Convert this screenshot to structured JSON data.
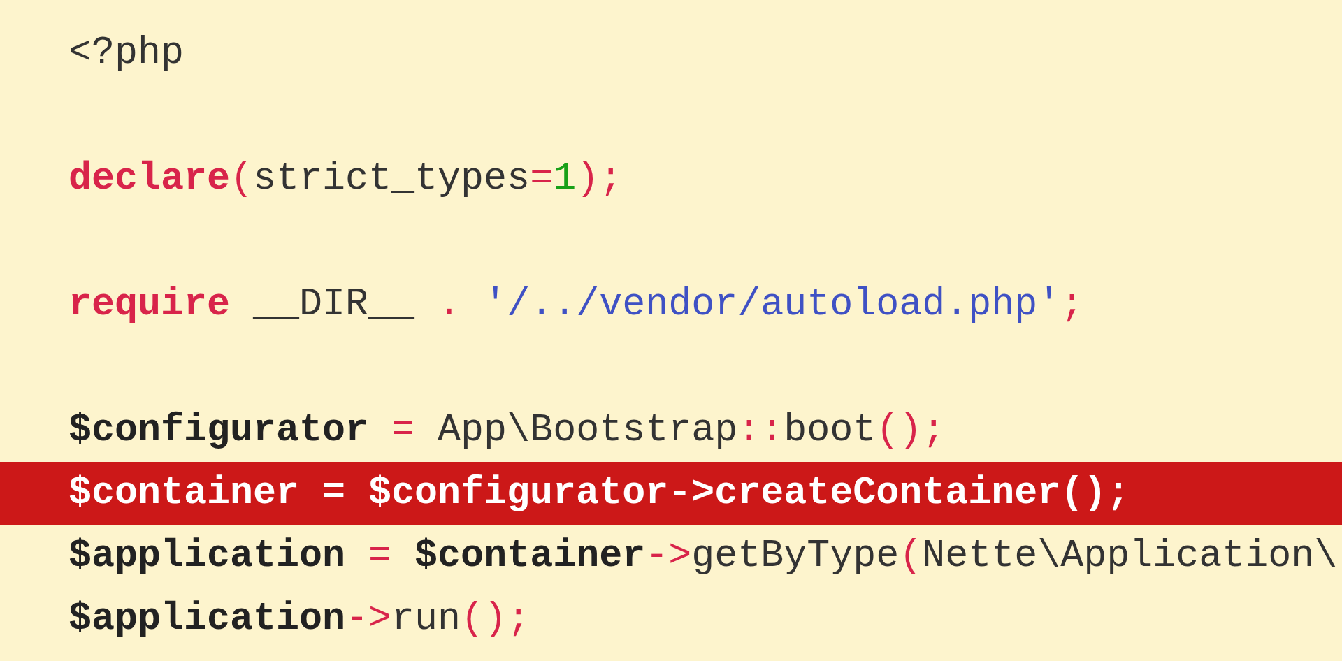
{
  "code_lines": [
    {
      "kind": "code",
      "highlighted": false,
      "tokens": [
        {
          "text": "<?php",
          "kind": "plain"
        }
      ]
    },
    {
      "kind": "blank"
    },
    {
      "kind": "code",
      "highlighted": false,
      "tokens": [
        {
          "text": "declare",
          "kind": "keyword"
        },
        {
          "text": "(",
          "kind": "operator"
        },
        {
          "text": "strict_types",
          "kind": "plain"
        },
        {
          "text": "=",
          "kind": "operator"
        },
        {
          "text": "1",
          "kind": "number"
        },
        {
          "text": ");",
          "kind": "operator"
        }
      ]
    },
    {
      "kind": "blank"
    },
    {
      "kind": "code",
      "highlighted": false,
      "tokens": [
        {
          "text": "require",
          "kind": "keyword"
        },
        {
          "text": " __DIR__ ",
          "kind": "plain"
        },
        {
          "text": ". ",
          "kind": "operator"
        },
        {
          "text": "'/../vendor/autoload.php'",
          "kind": "string"
        },
        {
          "text": ";",
          "kind": "operator"
        }
      ]
    },
    {
      "kind": "blank"
    },
    {
      "kind": "code",
      "highlighted": false,
      "tokens": [
        {
          "text": "$configurator",
          "kind": "variable"
        },
        {
          "text": " = ",
          "kind": "operator"
        },
        {
          "text": "App\\Bootstrap",
          "kind": "plain"
        },
        {
          "text": "::",
          "kind": "operator"
        },
        {
          "text": "boot",
          "kind": "plain"
        },
        {
          "text": "();",
          "kind": "operator"
        }
      ]
    },
    {
      "kind": "code",
      "highlighted": true,
      "tokens": [
        {
          "text": "$container = $configurator->createContainer();",
          "kind": "plain"
        }
      ]
    },
    {
      "kind": "code",
      "highlighted": false,
      "tokens": [
        {
          "text": "$application",
          "kind": "variable"
        },
        {
          "text": " = ",
          "kind": "operator"
        },
        {
          "text": "$container",
          "kind": "variable"
        },
        {
          "text": "->",
          "kind": "operator"
        },
        {
          "text": "getByType",
          "kind": "plain"
        },
        {
          "text": "(",
          "kind": "operator"
        },
        {
          "text": "Nette\\Application\\",
          "kind": "plain"
        }
      ]
    },
    {
      "kind": "code",
      "highlighted": false,
      "tokens": [
        {
          "text": "$application",
          "kind": "variable"
        },
        {
          "text": "->",
          "kind": "operator"
        },
        {
          "text": "run",
          "kind": "plain"
        },
        {
          "text": "();",
          "kind": "operator"
        }
      ]
    }
  ]
}
